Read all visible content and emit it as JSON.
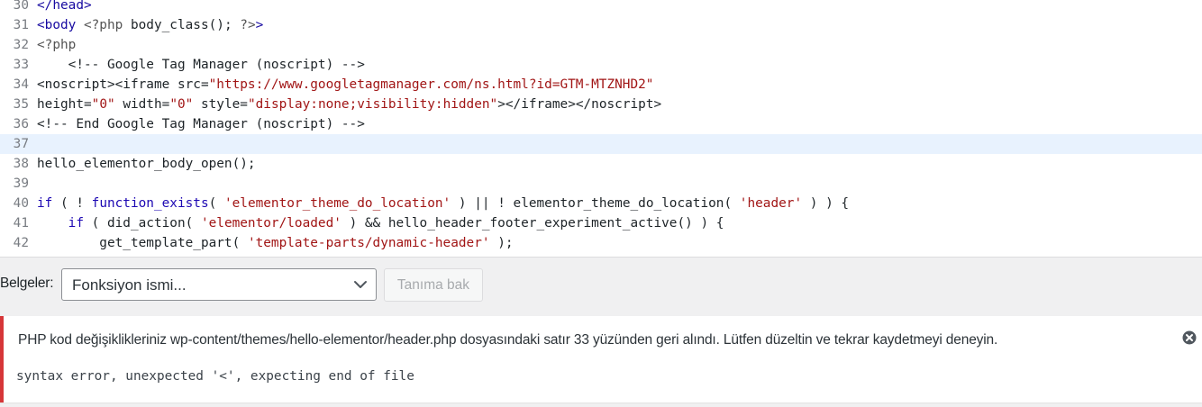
{
  "editor": {
    "active_line": 37,
    "lines": [
      {
        "num": "30",
        "tokens": [
          {
            "c": "t-tag",
            "t": "</head>"
          }
        ]
      },
      {
        "num": "31",
        "tokens": [
          {
            "c": "t-tag",
            "t": "<body "
          },
          {
            "c": "t-meta",
            "t": "<?php"
          },
          {
            "c": "t-def",
            "t": " body_class(); "
          },
          {
            "c": "t-meta",
            "t": "?>"
          },
          {
            "c": "t-tag",
            "t": ">"
          }
        ]
      },
      {
        "num": "32",
        "tokens": [
          {
            "c": "t-meta",
            "t": "<?php"
          }
        ]
      },
      {
        "num": "33",
        "tokens": [
          {
            "c": "t-cmt",
            "t": "    <!-- Google Tag Manager (noscript) -->"
          }
        ]
      },
      {
        "num": "34",
        "tokens": [
          {
            "c": "t-def",
            "t": "<noscript><iframe src="
          },
          {
            "c": "t-str",
            "t": "\"https://www.googletagmanager.com/ns.html?id=GTM-MTZNHD2\""
          }
        ]
      },
      {
        "num": "35",
        "tokens": [
          {
            "c": "t-def",
            "t": "height="
          },
          {
            "c": "t-str",
            "t": "\"0\""
          },
          {
            "c": "t-def",
            "t": " width="
          },
          {
            "c": "t-str",
            "t": "\"0\""
          },
          {
            "c": "t-def",
            "t": " style="
          },
          {
            "c": "t-str",
            "t": "\"display:none;visibility:hidden\""
          },
          {
            "c": "t-def",
            "t": "></iframe></noscript>"
          }
        ]
      },
      {
        "num": "36",
        "tokens": [
          {
            "c": "t-cmt",
            "t": "<!-- End Google Tag Manager (noscript) -->"
          }
        ]
      },
      {
        "num": "37",
        "tokens": []
      },
      {
        "num": "38",
        "tokens": [
          {
            "c": "t-def",
            "t": "hello_elementor_body_open();"
          }
        ]
      },
      {
        "num": "39",
        "tokens": []
      },
      {
        "num": "40",
        "tokens": [
          {
            "c": "t-kw",
            "t": "if"
          },
          {
            "c": "t-def",
            "t": " ( ! "
          },
          {
            "c": "t-kw",
            "t": "function_exists"
          },
          {
            "c": "t-def",
            "t": "( "
          },
          {
            "c": "t-str",
            "t": "'elementor_theme_do_location'"
          },
          {
            "c": "t-def",
            "t": " ) || ! elementor_theme_do_location( "
          },
          {
            "c": "t-str",
            "t": "'header'"
          },
          {
            "c": "t-def",
            "t": " ) ) {"
          }
        ]
      },
      {
        "num": "41",
        "tokens": [
          {
            "c": "t-def",
            "t": "    "
          },
          {
            "c": "t-kw",
            "t": "if"
          },
          {
            "c": "t-def",
            "t": " ( did_action( "
          },
          {
            "c": "t-str",
            "t": "'elementor/loaded'"
          },
          {
            "c": "t-def",
            "t": " ) && hello_header_footer_experiment_active() ) {"
          }
        ]
      },
      {
        "num": "42",
        "tokens": [
          {
            "c": "t-def",
            "t": "        get_template_part( "
          },
          {
            "c": "t-str",
            "t": "'template-parts/dynamic-header'"
          },
          {
            "c": "t-def",
            "t": " );"
          }
        ]
      }
    ]
  },
  "toolbar": {
    "docs_label": "Belgeler:",
    "select_value": "Fonksiyon ismi...",
    "lookup_button": "Tanıma bak"
  },
  "notice": {
    "message": "PHP kod değişiklikleriniz wp-content/themes/hello-elementor/header.php dosyasındaki satır 33 yüzünden geri alındı. Lütfen düzeltin ve tekrar kaydetmeyi deneyin.",
    "error": "syntax error, unexpected '<', expecting end of file",
    "dismiss_icon": "dismiss-icon"
  },
  "colors": {
    "error_accent": "#d63638",
    "active_line_bg": "#e8f2fe",
    "string": "#a11515",
    "keyword": "#1d08b3",
    "tag": "#170aa1"
  }
}
